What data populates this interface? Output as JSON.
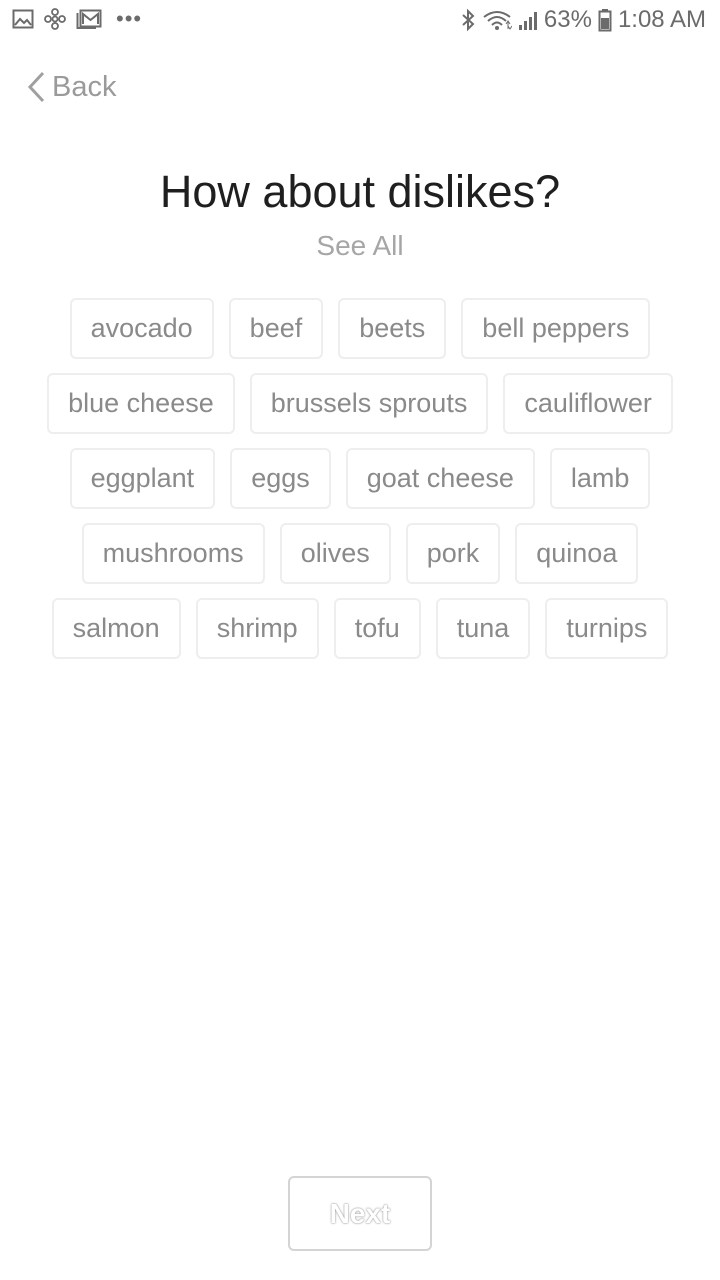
{
  "status_bar": {
    "left_icons": [
      "gallery-icon",
      "fan-icon",
      "gmail-icon"
    ],
    "more": "•••",
    "battery_percent": "63%",
    "time": "1:08 AM",
    "right_icons": [
      "bluetooth-icon",
      "wifi-icon",
      "signal-icon",
      "battery-icon"
    ]
  },
  "nav": {
    "back_label": "Back"
  },
  "header": {
    "title": "How about dislikes?",
    "see_all": "See All"
  },
  "chips": [
    "avocado",
    "beef",
    "beets",
    "bell peppers",
    "blue cheese",
    "brussels sprouts",
    "cauliflower",
    "eggplant",
    "eggs",
    "goat cheese",
    "lamb",
    "mushrooms",
    "olives",
    "pork",
    "quinoa",
    "salmon",
    "shrimp",
    "tofu",
    "tuna",
    "turnips"
  ],
  "footer": {
    "next_label": "Next"
  }
}
